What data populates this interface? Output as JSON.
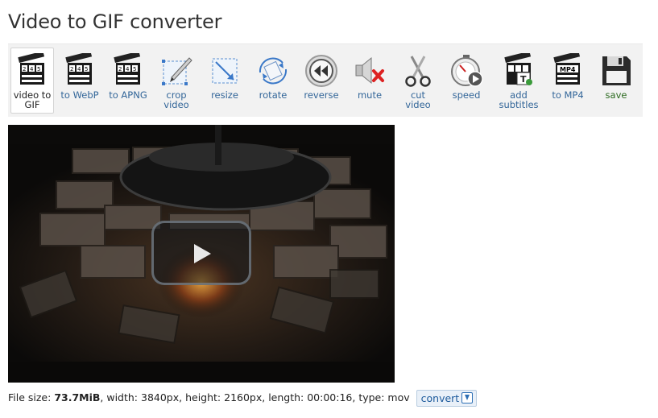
{
  "page": {
    "title": "Video to GIF converter"
  },
  "toolbar": {
    "tools": [
      {
        "id": "video-to-gif",
        "label": "video to GIF",
        "icon": "clapperboard-icon"
      },
      {
        "id": "to-webp",
        "label": "to WebP",
        "icon": "clapperboard-icon"
      },
      {
        "id": "to-apng",
        "label": "to APNG",
        "icon": "clapperboard-icon"
      },
      {
        "id": "crop-video",
        "label": "crop video",
        "icon": "crop-icon"
      },
      {
        "id": "resize",
        "label": "resize",
        "icon": "resize-icon"
      },
      {
        "id": "rotate",
        "label": "rotate",
        "icon": "rotate-icon"
      },
      {
        "id": "reverse",
        "label": "reverse",
        "icon": "rewind-icon"
      },
      {
        "id": "mute",
        "label": "mute",
        "icon": "speaker-muted-icon"
      },
      {
        "id": "cut-video",
        "label": "cut video",
        "icon": "scissors-icon"
      },
      {
        "id": "speed",
        "label": "speed",
        "icon": "stopwatch-icon"
      },
      {
        "id": "add-subtitles",
        "label": "add subtitles",
        "icon": "subtitles-icon"
      },
      {
        "id": "to-mp4",
        "label": "to MP4",
        "icon": "clapperboard-mp4-icon"
      },
      {
        "id": "save",
        "label": "save",
        "icon": "floppy-disk-icon"
      }
    ],
    "clap_digits": "2 4 5",
    "mp4_text": "MP4",
    "subtitle_mark": "T"
  },
  "file_info": {
    "size_label": "File size: ",
    "size_value": "73.7MiB",
    "details": ", width: 3840px, height: 2160px, length: 00:00:16, type: mov",
    "convert_label": "convert"
  },
  "colors": {
    "link": "#336699",
    "save": "#2b6a1f",
    "convert_bg": "#e9f0f8",
    "toolbar_bg": "#f2f2f2"
  }
}
